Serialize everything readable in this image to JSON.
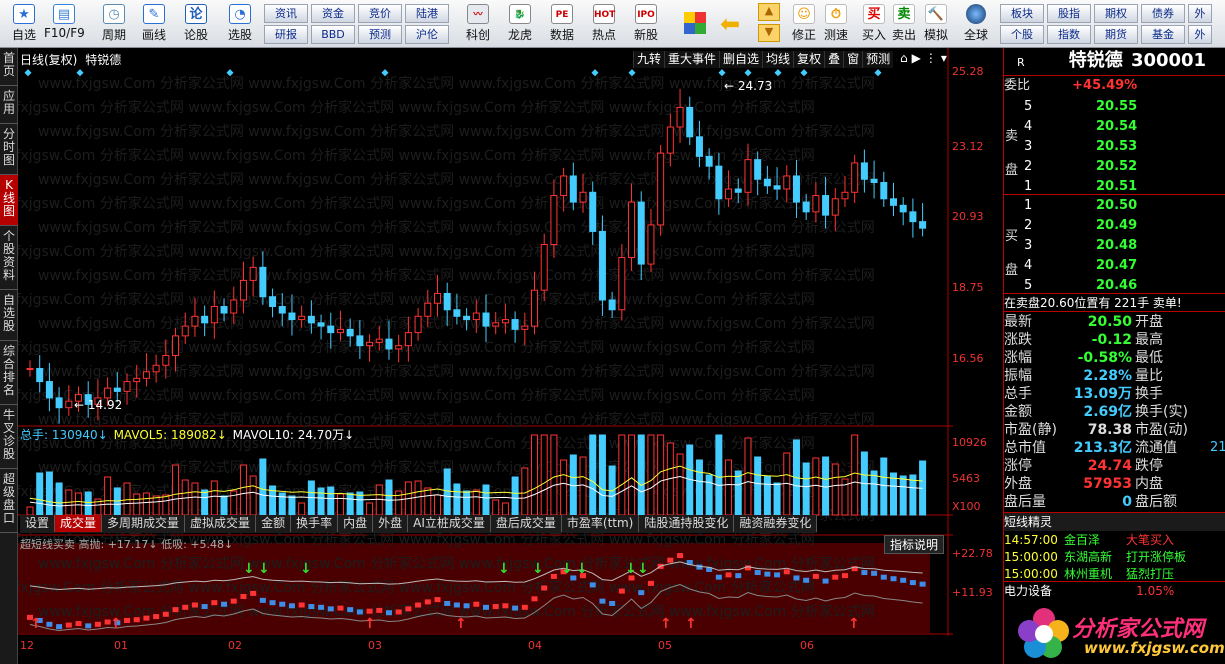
{
  "toolbar": {
    "main": [
      {
        "label": "自选",
        "icon": "star-icon"
      },
      {
        "label": "F10/F9",
        "icon": "f10-icon"
      },
      {
        "label": "周期",
        "icon": "clock-icon"
      },
      {
        "label": "画线",
        "icon": "pencil-icon"
      },
      {
        "label": "论股",
        "icon": "discuss-icon"
      },
      {
        "label": "选股",
        "icon": "select-stock-icon"
      }
    ],
    "grid": [
      [
        "资讯",
        "资金",
        "竞价",
        "陆港"
      ],
      [
        "研报",
        "BBD",
        "预测",
        "沪伦"
      ]
    ],
    "feature": [
      {
        "label": "科创",
        "icon": "kechuang-icon"
      },
      {
        "label": "龙虎",
        "icon": "dragon-tiger-icon"
      },
      {
        "label": "数据",
        "icon": "pe-icon"
      },
      {
        "label": "热点",
        "icon": "hot-icon"
      },
      {
        "label": "新股",
        "icon": "ipo-icon"
      }
    ],
    "action": [
      {
        "label": "修正",
        "icon": "fix-icon"
      },
      {
        "label": "测速",
        "icon": "speed-icon"
      },
      {
        "label": "买入",
        "icon": "buy-icon",
        "glyph": "买"
      },
      {
        "label": "卖出",
        "icon": "sell-icon",
        "glyph": "卖"
      },
      {
        "label": "模拟",
        "icon": "simulate-icon"
      }
    ],
    "global": "全球",
    "grid2": [
      [
        "板块",
        "股指",
        "期权",
        "债券",
        "外"
      ],
      [
        "个股",
        "指数",
        "期货",
        "基金",
        "外"
      ]
    ]
  },
  "lefttabs": [
    "首页",
    "应用",
    "分时图",
    "K线图",
    "个股资料",
    "自选股",
    "综合排名",
    "牛叉诊股",
    "超级盘口"
  ],
  "chart": {
    "title": "日线(复权)",
    "name": "特锐德",
    "topbar": [
      "九转",
      "重大事件",
      "删自选",
      "均线",
      "复权",
      "叠",
      "窗",
      "预测"
    ],
    "price_labels": [
      "25.28",
      "23.12",
      "20.93",
      "18.75",
      "16.56"
    ],
    "high_note": "24.73",
    "low_note": "14.92",
    "vol_header": {
      "total": "总手: 130940↓",
      "mavol5": "MAVOL5: 189082↓",
      "mavol10": "MAVOL10: 24.70万↓"
    },
    "vol_labels": [
      "10926",
      "5463",
      "X100"
    ],
    "ind_tabs": [
      "设置",
      "成交量",
      "多周期成交量",
      "虚拟成交量",
      "金额",
      "换手率",
      "内盘",
      "外盘",
      "AI立桩成交量",
      "盘后成交量",
      "市盈率(ttm)",
      "陆股通持股变化",
      "融资融券变化"
    ],
    "ind_title": "超短线买卖 高抛: +17.17↓ 低吸: +5.48↓",
    "ind_help": "指标说明",
    "ind_labels": [
      "+22.78",
      "+11.93"
    ],
    "months": [
      "12",
      "01",
      "02",
      "03",
      "04",
      "05",
      "06"
    ],
    "watermark": "www.fxjgsw.Com 分析家公式网"
  },
  "chart_data": {
    "type": "candlestick",
    "title": "特锐德 日线(复权)",
    "ylim": [
      14.5,
      25.5
    ],
    "high": 24.73,
    "low": 14.92,
    "closes": [
      16.2,
      15.8,
      15.3,
      15.0,
      15.2,
      15.4,
      15.1,
      15.3,
      15.6,
      15.5,
      15.8,
      15.9,
      16.1,
      16.3,
      16.6,
      17.2,
      17.5,
      17.8,
      17.6,
      18.1,
      17.9,
      18.3,
      18.9,
      19.3,
      18.4,
      18.1,
      17.9,
      17.7,
      17.8,
      17.6,
      17.5,
      17.3,
      17.4,
      17.2,
      16.9,
      17.0,
      17.1,
      16.8,
      16.9,
      17.3,
      17.8,
      18.2,
      18.5,
      18.0,
      17.8,
      17.7,
      17.9,
      17.5,
      17.6,
      17.7,
      17.4,
      17.5,
      18.6,
      20.0,
      21.5,
      22.1,
      21.3,
      21.6,
      20.4,
      18.3,
      18.0,
      19.6,
      21.3,
      19.4,
      20.6,
      22.8,
      23.6,
      24.2,
      23.3,
      22.7,
      22.4,
      21.4,
      21.7,
      21.6,
      22.6,
      22.0,
      21.8,
      21.7,
      22.1,
      21.3,
      21.0,
      21.5,
      20.9,
      21.4,
      21.6,
      22.5,
      22.0,
      21.9,
      21.4,
      21.2,
      21.0,
      20.7,
      20.5
    ],
    "volume_ylim": [
      0,
      10926
    ],
    "indicator": {
      "name": "超短线买卖",
      "高抛": 17.17,
      "低吸": 5.48,
      "ylim": [
        0,
        22.78
      ]
    }
  },
  "right": {
    "code_tag": "R",
    "name": "特锐德",
    "code": "300001",
    "wei_label": "委比",
    "wei_value": "+45.49%",
    "sell_label": [
      "卖",
      "盘"
    ],
    "buy_label": [
      "买",
      "盘"
    ],
    "sells": [
      {
        "n": "5",
        "p": "20.55"
      },
      {
        "n": "4",
        "p": "20.54"
      },
      {
        "n": "3",
        "p": "20.53"
      },
      {
        "n": "2",
        "p": "20.52"
      },
      {
        "n": "1",
        "p": "20.51"
      }
    ],
    "buys": [
      {
        "n": "1",
        "p": "20.50"
      },
      {
        "n": "2",
        "p": "20.49"
      },
      {
        "n": "3",
        "p": "20.48"
      },
      {
        "n": "4",
        "p": "20.47"
      },
      {
        "n": "5",
        "p": "20.46"
      }
    ],
    "ticker": "在卖盘20.60位置有  221手  卖单!",
    "stats": [
      {
        "k": "最新",
        "v": "20.50",
        "k2": "开盘",
        "c": "#3f3"
      },
      {
        "k": "涨跌",
        "v": "-0.12",
        "k2": "最高",
        "c": "#3f3"
      },
      {
        "k": "涨幅",
        "v": "-0.58%",
        "k2": "最低",
        "c": "#3f3"
      },
      {
        "k": "振幅",
        "v": "2.28%",
        "k2": "量比",
        "c": "#4cf"
      },
      {
        "k": "总手",
        "v": "13.09万",
        "k2": "换手",
        "c": "#4cf"
      },
      {
        "k": "金额",
        "v": "2.69亿",
        "k2": "换手(实)",
        "c": "#4cf"
      },
      {
        "k": "市盈(静)",
        "v": "78.38",
        "k2": "市盈(动)",
        "c": "#ddd"
      },
      {
        "k": "总市值",
        "v": "213.3亿",
        "k2": "流通值",
        "c": "#4cf"
      },
      {
        "k": "涨停",
        "v": "24.74",
        "k2": "跌停",
        "c": "#f33"
      },
      {
        "k": "外盘",
        "v": "57953",
        "k2": "内盘",
        "c": "#f33"
      },
      {
        "k": "盘后量",
        "v": "0",
        "k2": "盘后额",
        "c": "#4cf"
      }
    ],
    "extra_right": "21",
    "spirit_title": "短线精灵",
    "spirit": [
      {
        "t": "14:57:00",
        "name": "金百泽",
        "ev": "大笔买入"
      },
      {
        "t": "15:00:00",
        "name": "东湖高新",
        "ev": "打开涨停板"
      },
      {
        "t": "15:00:00",
        "name": "林州重机",
        "ev": "猛烈打压"
      }
    ],
    "sector": "电力设备",
    "sector_pct": "1.05%",
    "logo_text": "分析家公式网",
    "logo_url": "www.fxjgsw.com"
  }
}
